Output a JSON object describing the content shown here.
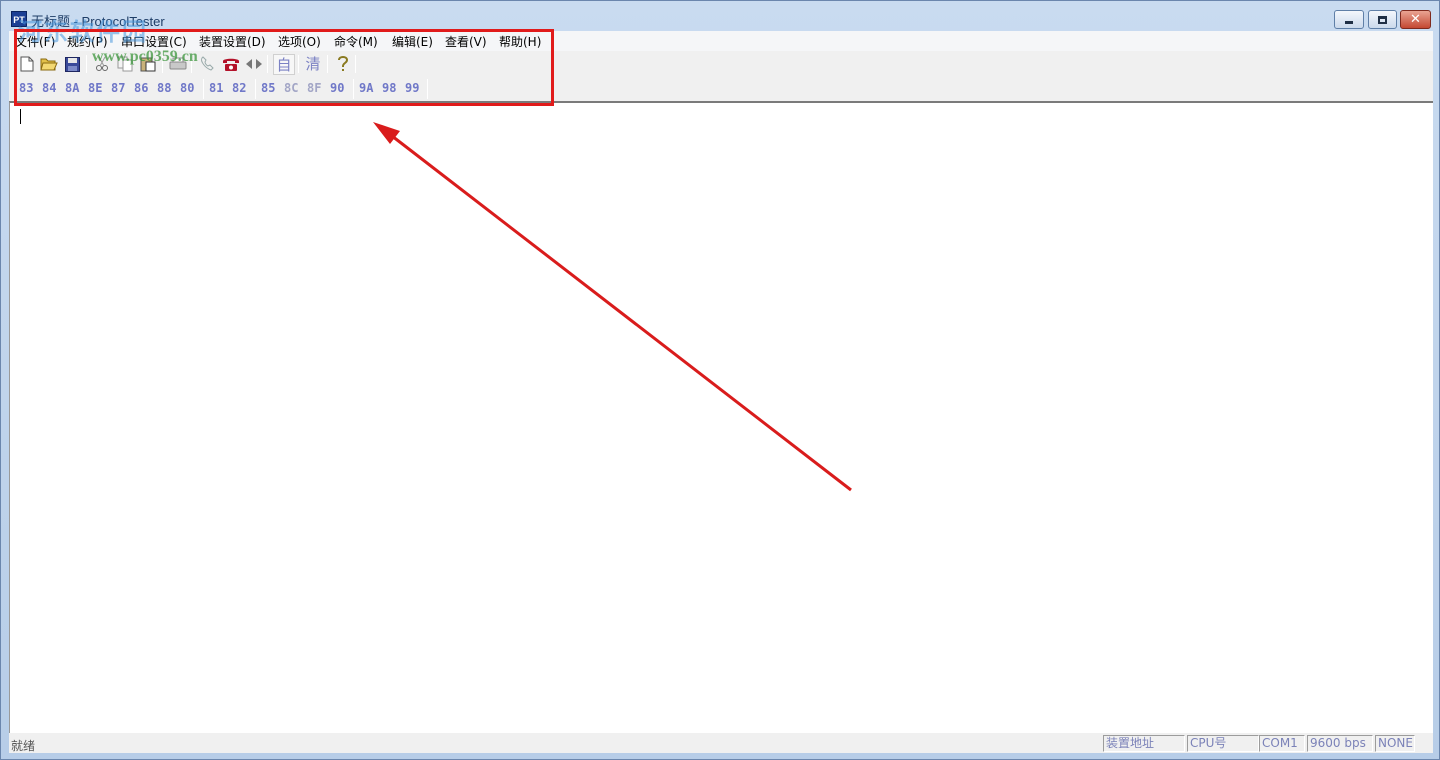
{
  "window": {
    "title": "无标题 - ProtocolTester",
    "app_icon_text": "PT",
    "min_label": "minimize",
    "max_label": "maximize",
    "close_label": "close"
  },
  "menu": {
    "items": [
      "文件(F)",
      "规约(P)",
      "串口设置(C)",
      "装置设置(D)",
      "选项(O)",
      "命令(M)",
      "编辑(E)",
      "查看(V)",
      "帮助(H)"
    ]
  },
  "toolbar": {
    "icons": [
      "new-file-icon",
      "open-folder-icon",
      "save-icon",
      "cut-icon",
      "copy-icon",
      "paste-icon",
      "print-icon",
      "phone-handset-icon",
      "telephone-icon",
      "connect-icon"
    ],
    "auto_label": "自",
    "clear_label": "清",
    "help_icon": "help-icon"
  },
  "commands": {
    "group1": [
      "83",
      "84",
      "8A",
      "8E",
      "87",
      "86",
      "88",
      "80"
    ],
    "group2": [
      "81",
      "82"
    ],
    "group3": [
      "85",
      "8C",
      "8F",
      "90"
    ],
    "group4": [
      "9A",
      "98",
      "99"
    ]
  },
  "status": {
    "ready": "就绪",
    "device_address": "装置地址",
    "cpu": "CPU号",
    "port": "COM1",
    "baud": "9600 bps",
    "parity": "NONE"
  },
  "overlay": {
    "watermark_text": "河东软件园",
    "watermark_url": "www.pc0359.cn",
    "highlight_color": "#e11b1b"
  }
}
